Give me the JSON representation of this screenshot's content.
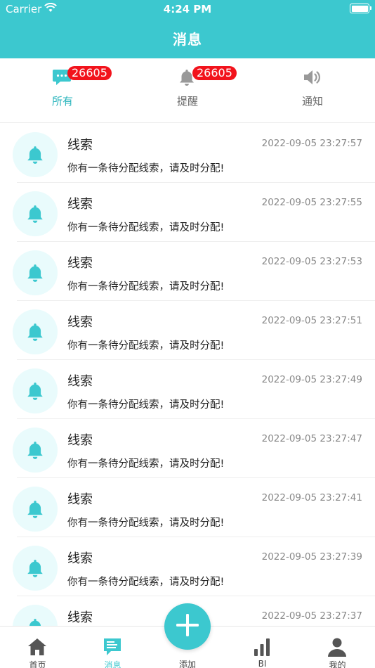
{
  "status_bar": {
    "carrier": "Carrier",
    "time": "4:24 PM"
  },
  "header": {
    "title": "消息"
  },
  "colors": {
    "accent": "#3cc8cf",
    "badge": "#f2131c",
    "avatar_bg": "#e9fbfc"
  },
  "tabs": [
    {
      "label": "所有",
      "badge": "26605",
      "icon": "chat-bubble-icon",
      "active": true
    },
    {
      "label": "提醒",
      "badge": "26605",
      "icon": "bell-icon",
      "active": false
    },
    {
      "label": "通知",
      "badge": "",
      "icon": "speaker-icon",
      "active": false
    }
  ],
  "messages": [
    {
      "title": "线索",
      "time": "2022-09-05 23:27:57",
      "text": "你有一条待分配线索，请及时分配!"
    },
    {
      "title": "线索",
      "time": "2022-09-05 23:27:55",
      "text": "你有一条待分配线索，请及时分配!"
    },
    {
      "title": "线索",
      "time": "2022-09-05 23:27:53",
      "text": "你有一条待分配线索，请及时分配!"
    },
    {
      "title": "线索",
      "time": "2022-09-05 23:27:51",
      "text": "你有一条待分配线索，请及时分配!"
    },
    {
      "title": "线索",
      "time": "2022-09-05 23:27:49",
      "text": "你有一条待分配线索，请及时分配!"
    },
    {
      "title": "线索",
      "time": "2022-09-05 23:27:47",
      "text": "你有一条待分配线索，请及时分配!"
    },
    {
      "title": "线索",
      "time": "2022-09-05 23:27:41",
      "text": "你有一条待分配线索，请及时分配!"
    },
    {
      "title": "线索",
      "time": "2022-09-05 23:27:39",
      "text": "你有一条待分配线索，请及时分配!"
    },
    {
      "title": "线索",
      "time": "2022-09-05 23:27:37",
      "text": ""
    }
  ],
  "tabbar": {
    "home": "首页",
    "messages": "消息",
    "add": "添加",
    "bi": "BI",
    "mine": "我的"
  }
}
